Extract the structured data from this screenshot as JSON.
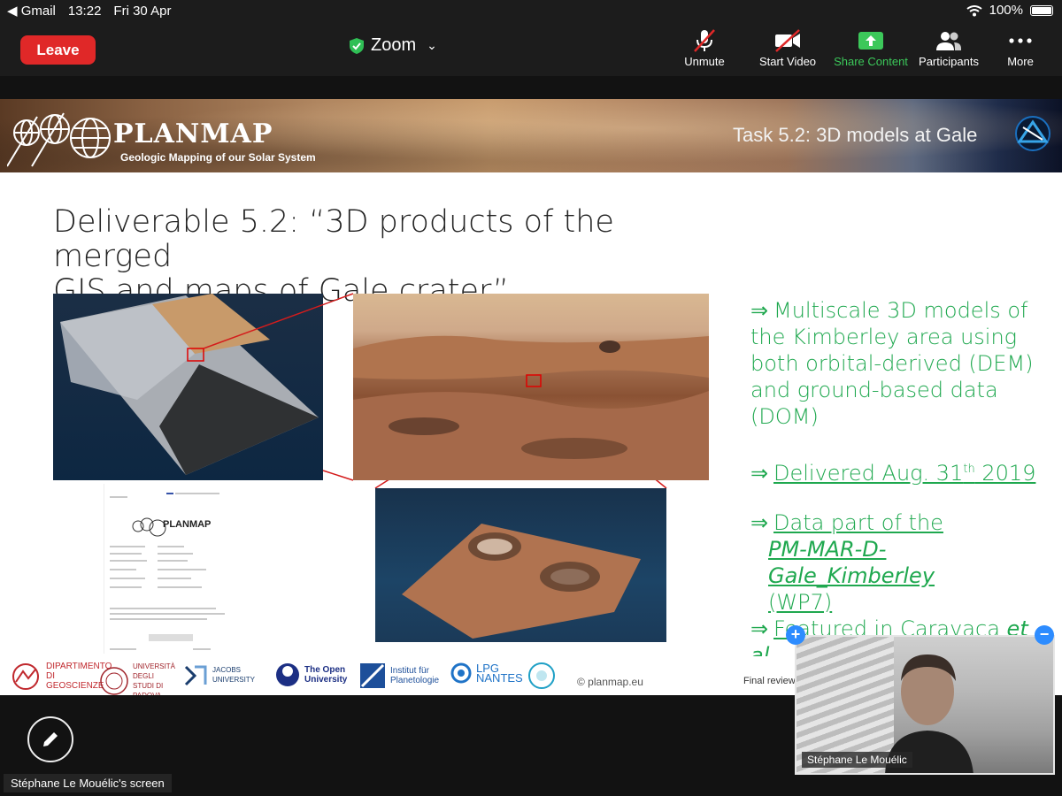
{
  "status_bar": {
    "back_app": "Gmail",
    "time": "13:22",
    "date": "Fri 30 Apr",
    "battery": "100%"
  },
  "topbar": {
    "leave_label": "Leave",
    "app_title": "Zoom",
    "tools": [
      {
        "label": "Unmute",
        "icon": "mic-muted-icon"
      },
      {
        "label": "Start Video",
        "icon": "video-off-icon"
      },
      {
        "label": "Share Content",
        "icon": "share-icon"
      },
      {
        "label": "Participants",
        "icon": "participants-icon"
      },
      {
        "label": "More",
        "icon": "more-icon"
      }
    ],
    "accent_color": "#3cc85a",
    "leave_color": "#e02828"
  },
  "slide": {
    "brand": "PLANMAP",
    "brand_subtitle": "Geologic Mapping of our Solar System",
    "task_title": "Task 5.2: 3D models at Gale",
    "title_line1": "Deliverable 5.2: “3D products of the merged",
    "title_line2": "GIS and maps of Gale crater”",
    "bullets": {
      "b1_arrow": "⇒",
      "b1_text": "Multiscale 3D models of the Kimberley area using both orbital-derived (DEM) and ground-based data (DOM)",
      "b2_arrow": "⇒",
      "b2_prefix": "Delivered Aug. 31",
      "b2_sup": "th",
      "b2_suffix": " 2019",
      "b3_arrow": "⇒",
      "b3_line1": "Data part of the",
      "b3_line2": "PM-MAR-D-Gale_Kimberley",
      "b3_line3": "(WP7)",
      "b4_arrow": "⇒",
      "b4_prefix": "Featured in Caravaca ",
      "b4_italic": "et al.",
      "b4_line2": "20"
    },
    "footer": {
      "logo1": "DIPARTIMENTO DI GEOSCIENZE",
      "logo2": "UNIVERSITÀ DEGLI STUDI DI PADOVA",
      "logo3": "JACOBS UNIVERSITY",
      "logo4": "The Open University",
      "logo5": "Institut für Planetologie",
      "logo6": "LPG NANTES",
      "copyright": "© planmap.eu",
      "final_review": "Final review"
    },
    "doc_brand": "PLANMAP",
    "bullet_color": "#1fa84f"
  },
  "bottom": {
    "screen_label": "Stéphane Le Mouélic's screen"
  },
  "video": {
    "participant_name": "Stéphane Le Mouélic",
    "add_label": "+",
    "remove_label": "−"
  }
}
